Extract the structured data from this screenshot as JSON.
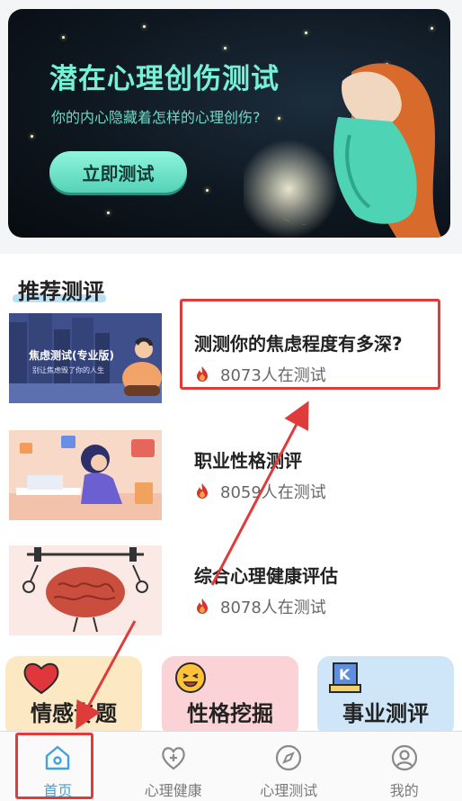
{
  "banner": {
    "title": "潜在心理创伤测试",
    "subtitle": "你的内心隐藏着怎样的心理创伤?",
    "button_label": "立即测试"
  },
  "section": {
    "title": "推荐测评"
  },
  "items": [
    {
      "title": "测测你的焦虑程度有多深?",
      "participants": "8073人在测试",
      "thumb_title": "焦虑测试(专业版)",
      "thumb_sub": "别让焦虑毁了你的人生"
    },
    {
      "title": "职业性格测评",
      "participants": "8059人在测试"
    },
    {
      "title": "综合心理健康评估",
      "participants": "8078人在测试"
    }
  ],
  "categories": [
    {
      "label": "情感专题",
      "icon": "heart-icon",
      "color": "#fde8c4"
    },
    {
      "label": "性格挖掘",
      "icon": "smiley-icon",
      "color": "#fbd3d6"
    },
    {
      "label": "事业测评",
      "icon": "k-board-icon",
      "color": "#cfe6f8"
    }
  ],
  "tabs": [
    {
      "label": "首页",
      "icon": "home-icon",
      "active": true
    },
    {
      "label": "心理健康",
      "icon": "heart-plus-icon",
      "active": false
    },
    {
      "label": "心理测试",
      "icon": "compass-icon",
      "active": false
    },
    {
      "label": "我的",
      "icon": "user-icon",
      "active": false
    }
  ],
  "colors": {
    "accent": "#3ea3e0",
    "banner_text": "#77f0d6",
    "annotation": "#e03b3b"
  }
}
